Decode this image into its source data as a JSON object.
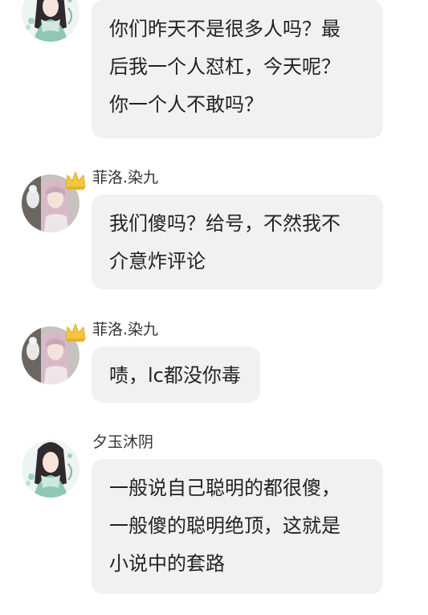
{
  "chat": {
    "messages": [
      {
        "sender": "",
        "avatar": "girl-illustration-avatar",
        "has_badge": false,
        "lines": [
          "你们昨天不是很多人吗？最",
          "后我一个人怼杠，今天呢？",
          "你一个人不敢吗？"
        ]
      },
      {
        "sender": "菲洛.染九",
        "avatar": "girl-photo-avatar",
        "has_badge": true,
        "badge": "crown-icon",
        "lines": [
          "我们傻吗？给号，不然我不",
          "介意炸评论"
        ]
      },
      {
        "sender": "菲洛.染九",
        "avatar": "girl-photo-avatar",
        "has_badge": true,
        "badge": "crown-icon",
        "lines": [
          "啧，lc都没你毒"
        ]
      },
      {
        "sender": "夕玉沐阴",
        "avatar": "girl-illustration-avatar",
        "has_badge": false,
        "lines": [
          "一般说自己聪明的都很傻，",
          "一般傻的聪明绝顶，这就是",
          "小说中的套路"
        ]
      }
    ]
  },
  "colors": {
    "bubble": "#f1f1f1",
    "text": "#222222",
    "sender": "#333333",
    "crown": "#f5c542"
  }
}
